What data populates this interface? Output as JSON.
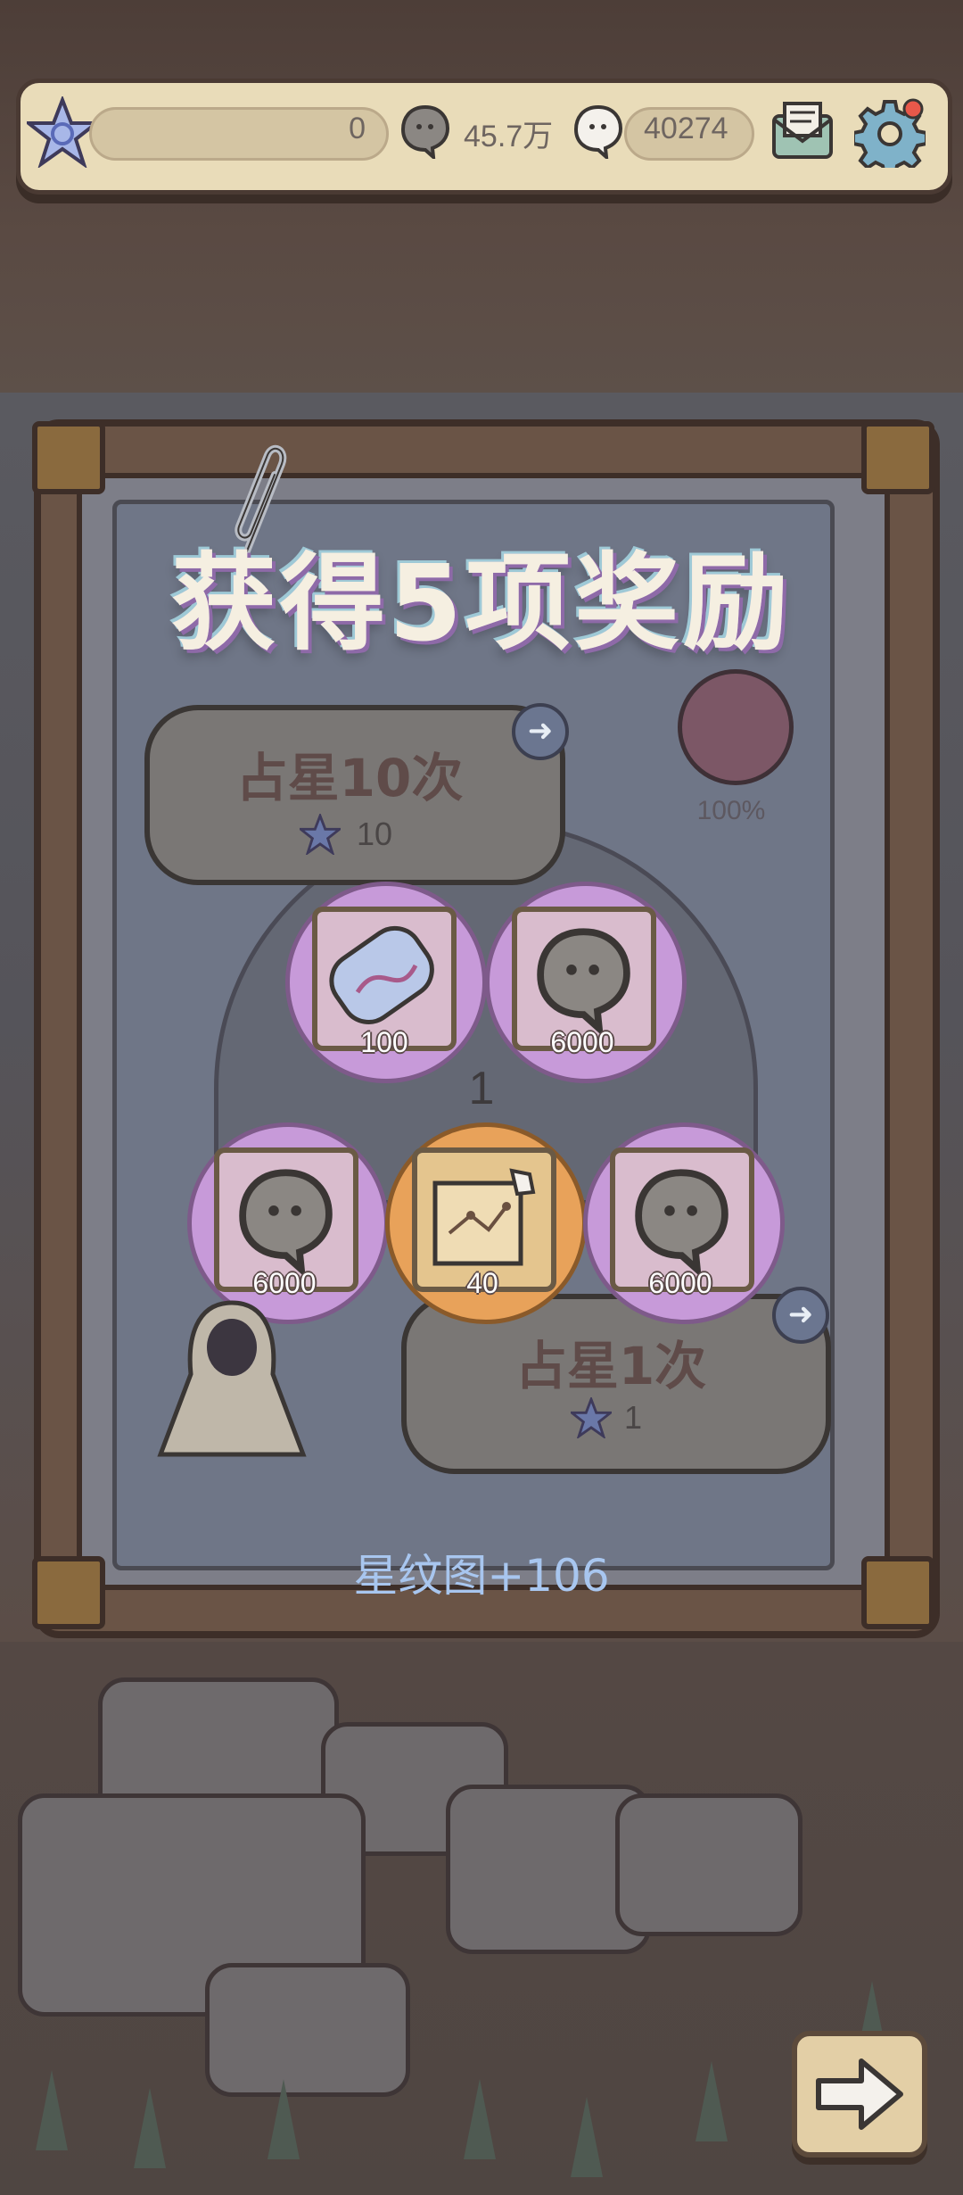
{
  "top_bar": {
    "star_count": "0",
    "gray_ghost_count": "45.7万",
    "white_ghost_count": "40274",
    "icons": [
      "star-icon",
      "gray-ghost-icon",
      "white-ghost-icon",
      "mail-icon",
      "settings-icon"
    ],
    "notification_dot_color": "#e8584a"
  },
  "dialog": {
    "title": "获得5项奖励",
    "draw_ten": {
      "label": "占星10次",
      "cost": "10"
    },
    "draw_one": {
      "label": "占星1次",
      "cost": "1"
    },
    "progress_label": "100%",
    "center_number": "1",
    "rewards": [
      {
        "name": "scroll",
        "qty": "100",
        "rarity": "purple"
      },
      {
        "name": "gray-ghost",
        "qty": "6000",
        "rarity": "purple"
      },
      {
        "name": "gray-ghost",
        "qty": "6000",
        "rarity": "purple"
      },
      {
        "name": "star-map",
        "qty": "40",
        "rarity": "orange"
      },
      {
        "name": "gray-ghost",
        "qty": "6000",
        "rarity": "purple"
      }
    ],
    "footer": "星纹图+106"
  },
  "colors": {
    "purple_orb": "#c79ad9",
    "orange_orb": "#e8a25a",
    "title_text": "#f5efe1",
    "footer_text": "#a8c6ef"
  }
}
